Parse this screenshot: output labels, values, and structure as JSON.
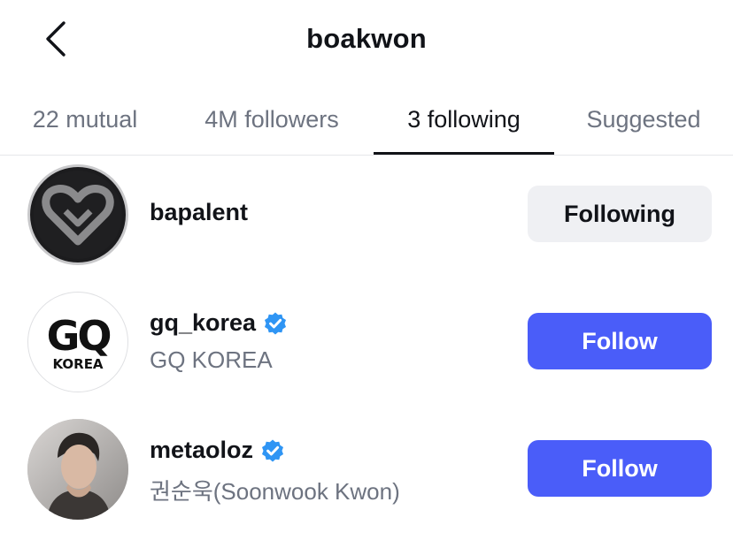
{
  "header": {
    "title": "boakwon"
  },
  "tabs": [
    {
      "label": "22 mutual"
    },
    {
      "label": "4M followers"
    },
    {
      "label": "3 following",
      "active": true
    },
    {
      "label": "Suggested"
    }
  ],
  "accounts": [
    {
      "username": "bapalent",
      "display_name": "",
      "verified": false,
      "button": "Following",
      "avatar": "bapalent-heart-logo"
    },
    {
      "username": "gq_korea",
      "display_name": "GQ KOREA",
      "verified": true,
      "button": "Follow",
      "avatar": "gq-korea-logo",
      "logo_text_top": "GQ",
      "logo_text_bottom": "KOREA"
    },
    {
      "username": "metaoloz",
      "display_name": "권순욱(Soonwook Kwon)",
      "verified": true,
      "button": "Follow",
      "avatar": "person-photo"
    }
  ],
  "colors": {
    "follow_button": "#4a5df9",
    "following_button": "#eff0f3",
    "verified_badge": "#2f95f4",
    "active_tab": "#111318",
    "inactive_tab": "#6d7380"
  }
}
